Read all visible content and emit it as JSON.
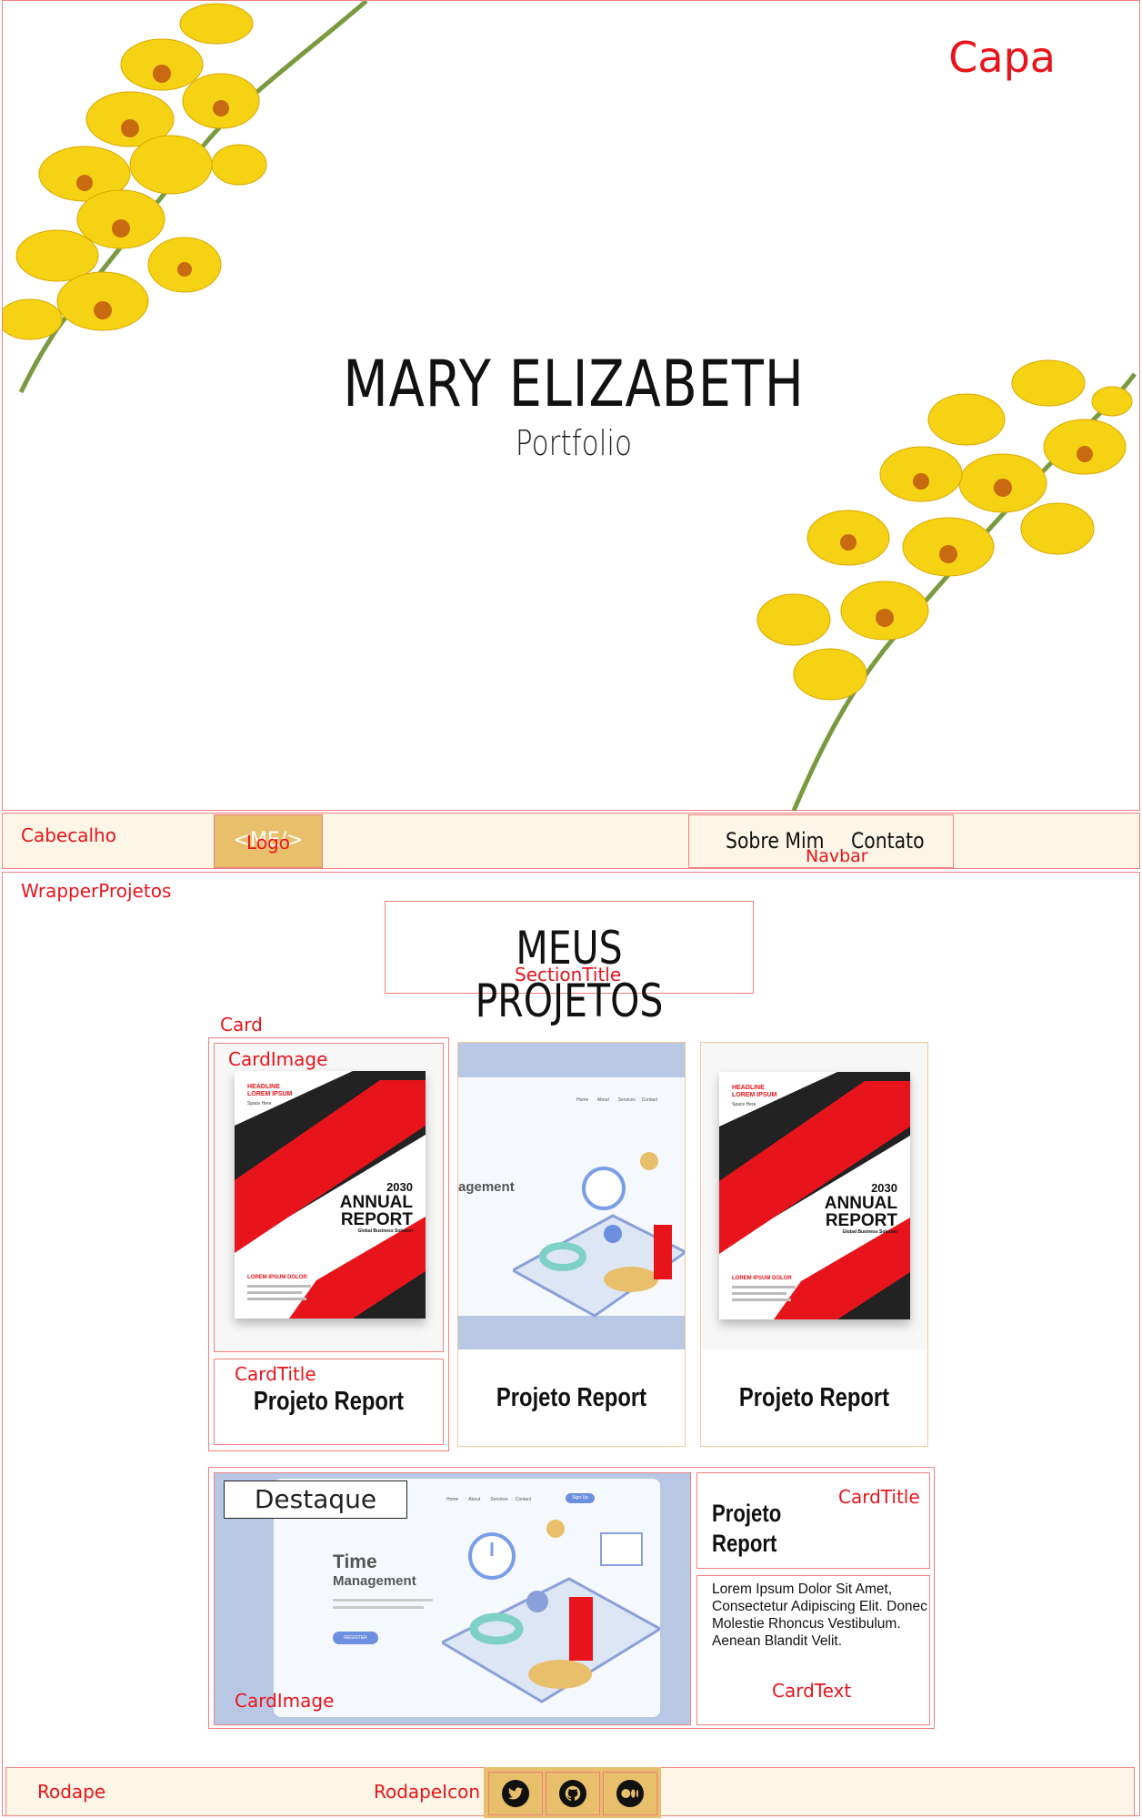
{
  "capa": {
    "label": "Capa",
    "name": "MARY ELIZABETH",
    "subtitle": "Portfolio"
  },
  "cabecalho": {
    "label": "Cabecalho",
    "logo_text": "<ME/>",
    "logo_label": "Logo",
    "nav_label": "Navbar",
    "nav_items": [
      "Sobre Mim",
      "Contato"
    ]
  },
  "wrapper": {
    "label": "WrapperProjetos"
  },
  "section": {
    "title": "MEUS PROJETOS",
    "label": "SectionTitle"
  },
  "annotations": {
    "card": "Card",
    "card_image": "CardImage",
    "card_title": "CardTitle",
    "card_text": "CardText"
  },
  "report_cover": {
    "headline": "HEADLINE\nLOREM IPSUM",
    "space": "Space Here",
    "year": "2030",
    "line1": "ANNUAL",
    "line2": "REPORT",
    "subtitle": "Global Business Solution",
    "lorem": "LOREM IPSUM DOLOR"
  },
  "time_mgmt": {
    "title": "Time",
    "title2": "Management",
    "nav": [
      "Home",
      "About",
      "Services",
      "Contact"
    ],
    "signup": "Sign Up",
    "register": "REGISTER"
  },
  "cards": [
    {
      "title": "Projeto Report"
    },
    {
      "title": "Projeto Report"
    },
    {
      "title": "Projeto Report"
    }
  ],
  "featured": {
    "tag": "Destaque",
    "title": "Projeto Report",
    "text": "Lorem Ipsum Dolor Sit Amet, Consectetur Adipiscing Elit. Donec Molestie Rhoncus Vestibulum. Aenean Blandit Velit."
  },
  "rodape": {
    "label": "Rodape",
    "icons_label": "RodapeIcon",
    "icons": [
      "twitter-icon",
      "github-icon",
      "medium-icon"
    ]
  },
  "colors": {
    "accent_red": "#e8141b",
    "gold": "#e8bf6b",
    "cream": "#fdf6e6",
    "flower_yellow": "#f6d214"
  }
}
